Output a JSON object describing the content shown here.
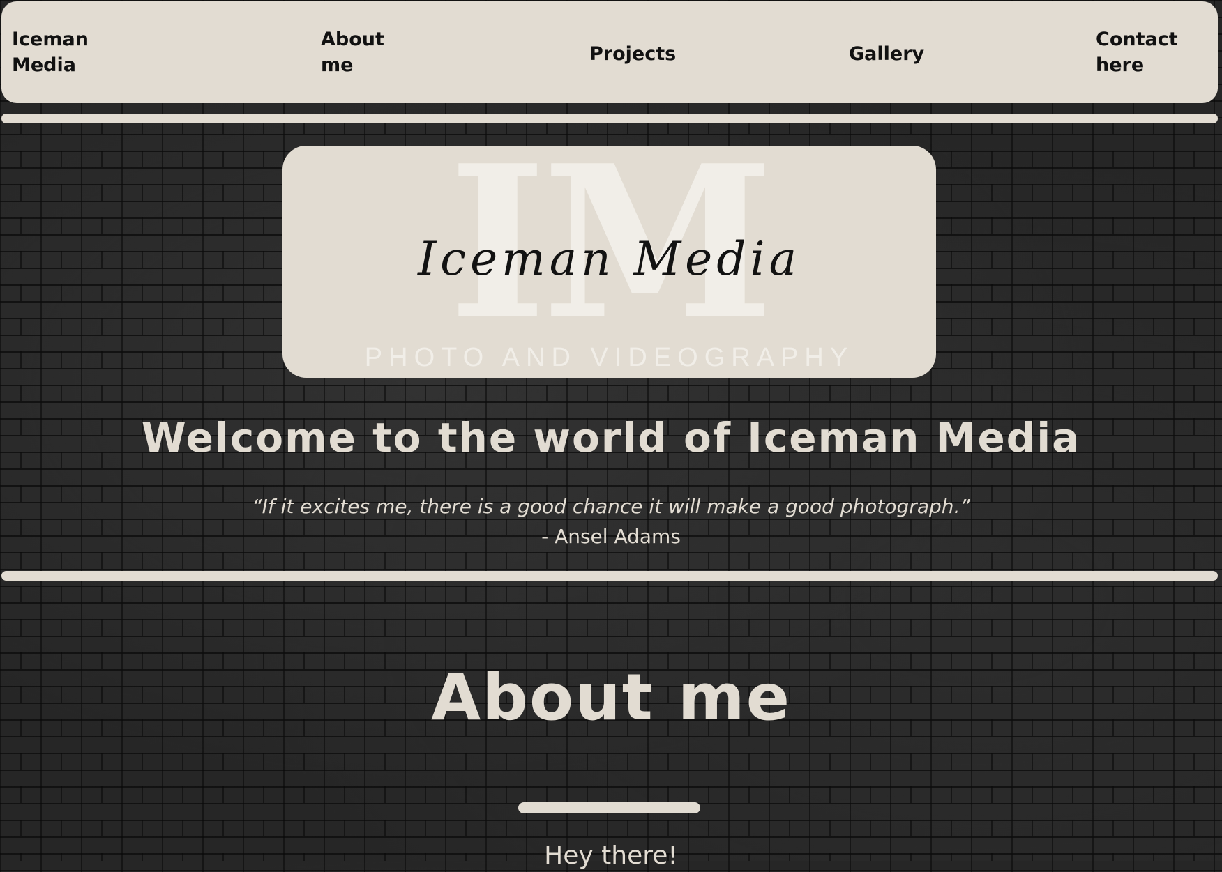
{
  "nav": {
    "brand": "Iceman Media",
    "items": [
      {
        "label": "About me"
      },
      {
        "label": "Projects"
      },
      {
        "label": "Gallery"
      },
      {
        "label": "Contact here"
      }
    ]
  },
  "logo": {
    "monogram": "IM",
    "script": "Iceman Media",
    "tagline": "PHOTO AND VIDEOGRAPHY"
  },
  "hero": {
    "title": "Welcome to the world of Iceman Media",
    "quote": "“If it excites me, there is a good chance it will make a good photograph.”",
    "author": "- Ansel Adams"
  },
  "about": {
    "heading": "About me",
    "greeting": "Hey there!"
  },
  "colors": {
    "cream": "#e2dcd2",
    "text_dark": "#111111",
    "brick": "#262626"
  }
}
